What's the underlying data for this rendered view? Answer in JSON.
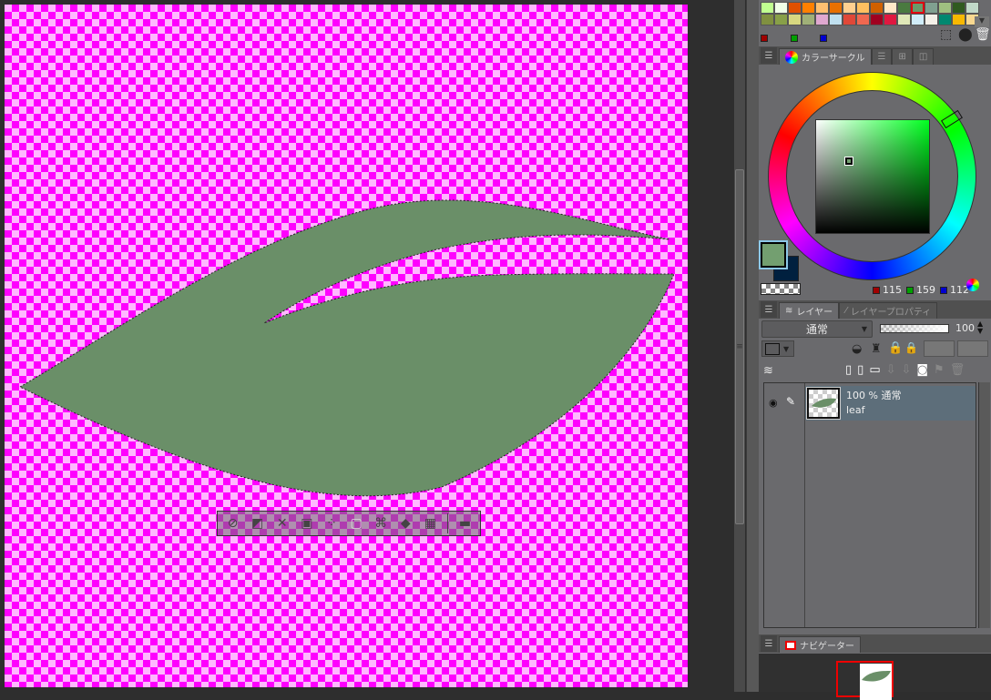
{
  "canvas": {
    "checker_a": "#ff00ff",
    "checker_b": "#ffb8ff",
    "leaf_color": "#6a8f68"
  },
  "float_toolbar": {
    "icons": [
      "deselect-icon",
      "invert-selection-icon",
      "expand-selection-icon",
      "shrink-selection-icon",
      "fill-selection-icon",
      "scale-rotate-icon",
      "transform-icon",
      "fill-bucket-icon",
      "clear-outside-icon",
      "more-settings-icon"
    ]
  },
  "palette": {
    "row1": [
      "#c0ff90",
      "#f0ffe8",
      "#e05000",
      "#ff8000",
      "#ffc070",
      "#e87000",
      "#ffd090",
      "#ffc060",
      "#d06000",
      "#ffe8c8",
      "#4a7a40",
      "#6a9a6a",
      "#80a090",
      "#a0c080",
      "#305a20",
      "#c0d8c8"
    ],
    "row2": [
      "#809040",
      "#88a048",
      "#d8d880",
      "#a0b078",
      "#e0a8d0",
      "#c0e0f0",
      "#e04838",
      "#f06850",
      "#a00020",
      "#e01840",
      "#e0e8b8",
      "#d0ecf8",
      "#f4f0e8",
      "#008870",
      "#f8b800",
      "#f8d890"
    ],
    "selected": 11
  },
  "color_circle": {
    "tab_label": "カラーサークル",
    "main_color": "#739f70",
    "sub_color": "#00203f",
    "r": "115",
    "g": "159",
    "b": "112"
  },
  "layer_panel": {
    "tab_label": "レイヤー",
    "tab2_label": "レイヤープロパティ",
    "blend_mode": "通常",
    "opacity": "100",
    "layers": [
      {
        "opacity_mode": "100 % 通常",
        "name": "leaf"
      }
    ]
  },
  "navigator": {
    "tab_label": "ナビゲーター"
  }
}
